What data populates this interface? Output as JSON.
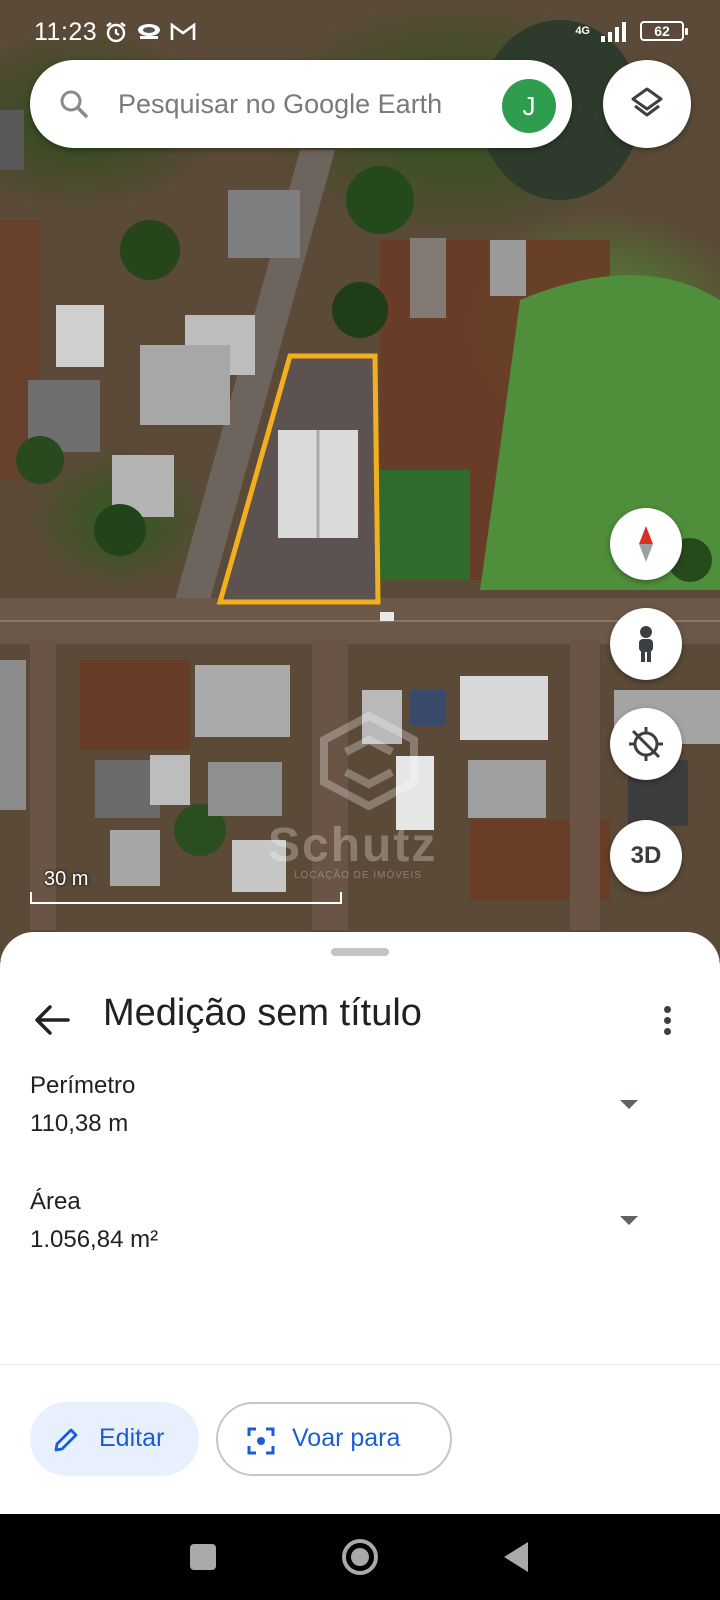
{
  "status_bar": {
    "time": "11:23",
    "network": "4G",
    "battery": "62"
  },
  "search": {
    "placeholder": "Pesquisar no Google Earth",
    "avatar_initial": "J"
  },
  "map": {
    "scale_label": "30 m",
    "fab_3d_label": "3D",
    "measurement_outline_color": "#f2b01e",
    "watermark": {
      "name": "Schutz",
      "subtitle": "LOCAÇÃO DE IMÓVEIS"
    }
  },
  "sheet": {
    "title": "Medição sem título",
    "measurements": [
      {
        "label": "Perímetro",
        "value": "110,38 m"
      },
      {
        "label": "Área",
        "value": "1.056,84 m²"
      }
    ],
    "edit_label": "Editar",
    "fly_label": "Voar para"
  },
  "colors": {
    "accent": "#1a5fd0",
    "avatar": "#2e9d4d",
    "edit_button_bg": "#e8f0fe"
  }
}
